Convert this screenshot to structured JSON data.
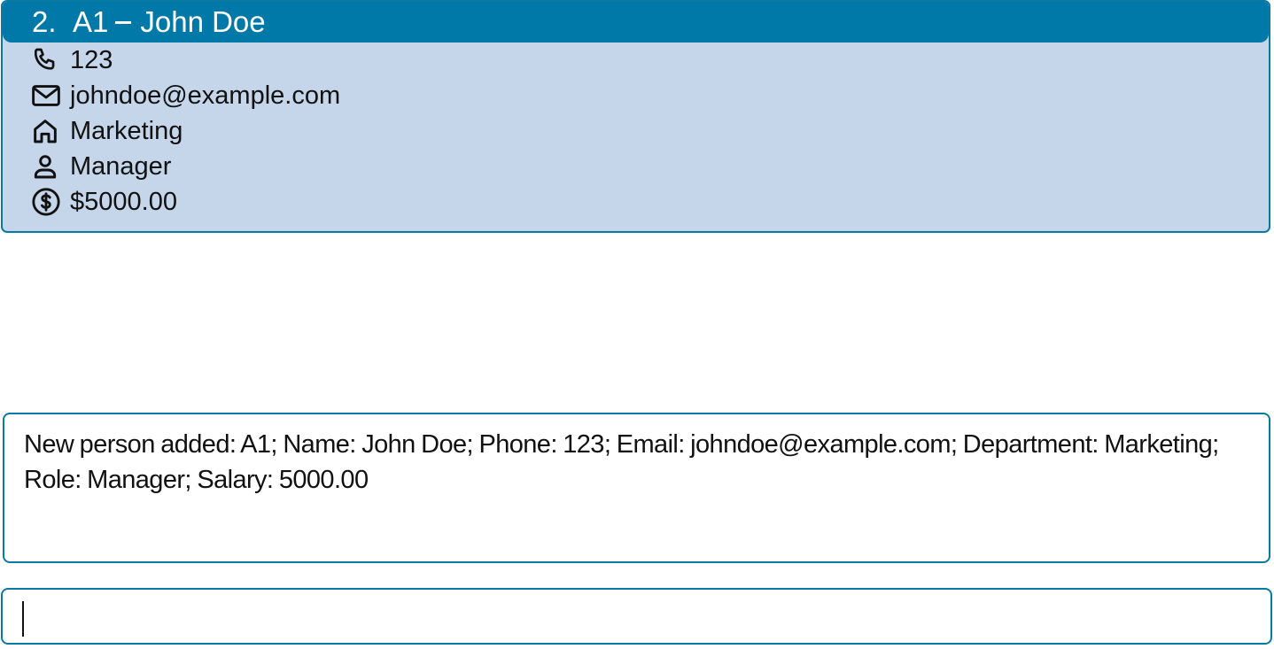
{
  "person_card": {
    "index": "2.",
    "id": "A1",
    "name": "John Doe",
    "phone": "123",
    "email": "johndoe@example.com",
    "department": "Marketing",
    "role": "Manager",
    "salary": "$5000.00",
    "icons": {
      "phone": "phone-icon",
      "email": "mail-icon",
      "department": "home-icon",
      "role": "person-icon",
      "salary": "dollar-circle-icon"
    }
  },
  "result_display": {
    "message": "New person added: A1; Name: John Doe; Phone: 123; Email: johndoe@example.com; Department: Marketing; Role: Manager; Salary: 5000.00"
  },
  "command_box": {
    "value": "",
    "placeholder": ""
  },
  "colors": {
    "accent": "#0078a8",
    "card_background": "#c5d5ea",
    "border": "#0a7aa3"
  }
}
